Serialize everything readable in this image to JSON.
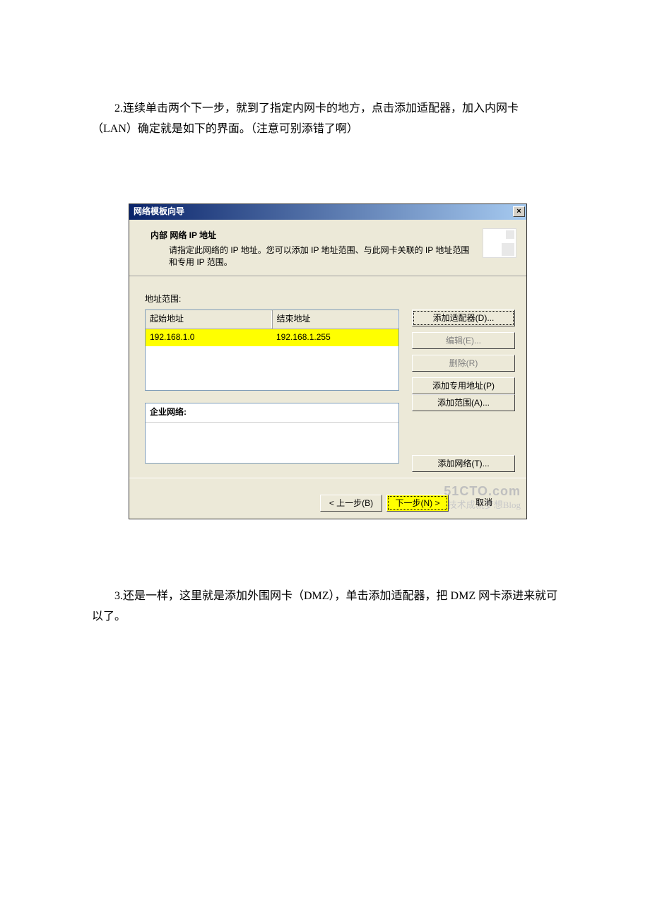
{
  "para2": "2.连续单击两个下一步，就到了指定内网卡的地方，点击添加适配器，加入内网卡（LAN）确定就是如下的界面。（注意可别添错了啊）",
  "para3": "3.还是一样，这里就是添加外围网卡（DMZ），单击添加适配器，把 DMZ 网卡添进来就可以了。",
  "dialog": {
    "title": "网络模板向导",
    "close": "×",
    "header_title": "内部 网络 IP 地址",
    "header_sub": "请指定此网络的 IP 地址。您可以添加 IP 地址范围、与此网卡关联的 IP 地址范围和专用 IP 范围。",
    "range_label": "地址范围:",
    "col_start": "起始地址",
    "col_end": "结束地址",
    "row_start": "192.168.1.0",
    "row_end": "192.168.1.255",
    "corp_label": "企业网络:",
    "buttons": {
      "add_adapter": "添加适配器(D)...",
      "edit": "编辑(E)...",
      "delete": "删除(R)",
      "add_private": "添加专用地址(P)",
      "add_range": "添加范围(A)...",
      "add_network": "添加网络(T)..."
    },
    "footer": {
      "back": "< 上一步(B)",
      "next": "下一步(N) >",
      "cancel": "取消"
    },
    "watermark": "51CTO.com",
    "watermark_sub": "技术成就梦想Blog"
  }
}
